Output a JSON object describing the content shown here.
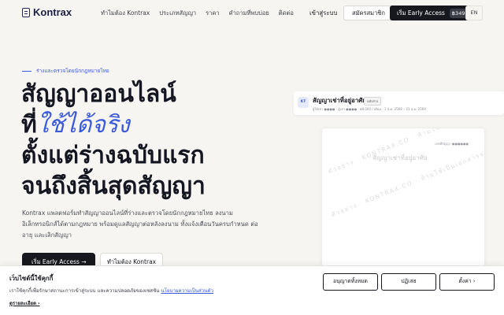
{
  "nav": {
    "brand": "Kontrax",
    "links": [
      "ทำไมต้อง Kontrax",
      "ประเภทสัญญา",
      "ราคา",
      "คำถามที่พบบ่อย",
      "ติดต่อ"
    ],
    "sign_in": "เข้าสู่ระบบ",
    "sign_up": "สมัครสมาชิก",
    "early_access": "เริ่ม Early Access",
    "early_price": "฿349",
    "lang": "EN"
  },
  "hero": {
    "eyebrow": "ร่างและตรวจโดยนักกฎหมายไทย",
    "title_line1": "สัญญาออนไลน์",
    "title_line2_plain": "ที่",
    "title_line2_accent": "ใช้ได้จริง",
    "title_line3": "ตั้งแต่ร่างฉบับแรก",
    "title_line4": "จนถึงสิ้นสุดสัญญา",
    "description": "Kontrax แพลตฟอร์มทำสัญญาออนไลน์ที่ร่างและตรวจโดยนักกฎหมายไทย ลงนามอิเล็กทรอนิกส์ได้ตามกฎหมาย พร้อมดูแลสัญญาต่อหลังลงนาม ทั้งแจ้งเตือนวันครบกำหนด ต่ออายุ และเลิกสัญญา",
    "cta_primary": "เริ่ม Early Access →",
    "cta_secondary": "ทำไมต้อง Kontrax"
  },
  "doc": {
    "avatar": "KT",
    "title": "สัญญาเช่าที่อยู่อาศัย",
    "badge": "ฉบับร่าง",
    "meta": "ผู้ให้เช่า ●●●● · ผู้เช่า ●●●● · ฿8,000 / เดือน · 1 ส.ค. 2568 – 31 ส.ค. 2569",
    "page_ref": "เลขที่สัญญา ●●●●●●",
    "page_title": "สัญญาเช่าที่อยู่อาศัย",
    "watermark_1": "ตัวอย่าง · KONTRAX.CO · ห้ามใช้เป็นเอกสารจริง",
    "watermark_2": "ตัวอย่าง · KONTRAX.CO · ห้ามใช้เป็นเอกสารจริง"
  },
  "cookie": {
    "title": "เว็บไซต์นี้ใช้คุกกี้",
    "text": "เราใช้คุกกี้เพื่อรักษาสถานะการเข้าสู่ระบบ และความปลอดภัยของเซสชัน",
    "link": "นโยบายความเป็นส่วนตัว",
    "more": "ดูรายละเอียด ›",
    "accept": "อนุญาตทั้งหมด",
    "reject": "ปฏิเสธ",
    "settings": "ตั้งค่า ›"
  }
}
